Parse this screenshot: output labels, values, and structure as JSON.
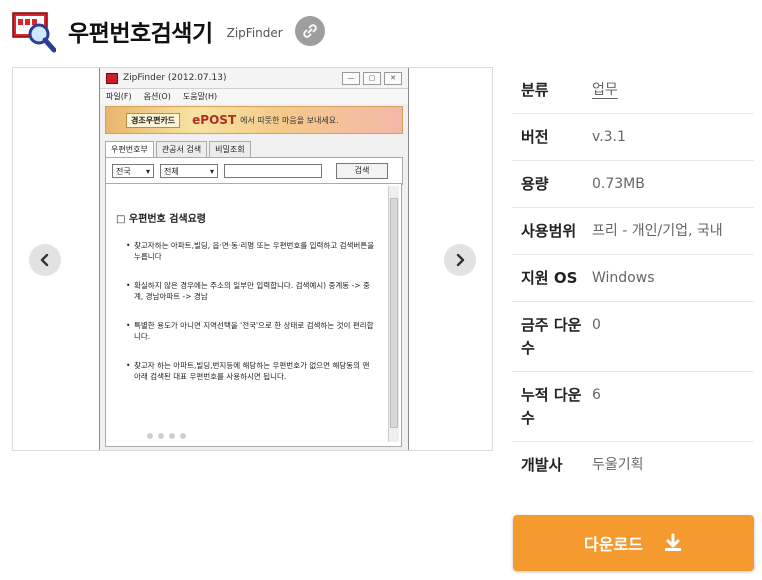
{
  "header": {
    "title": "우편번호검색기",
    "subtitle": "ZipFinder"
  },
  "screenshot": {
    "window_title": "ZipFinder (2012.07.13)",
    "menu": [
      "파일(F)",
      "옵션(O)",
      "도움말(H)"
    ],
    "banner": {
      "card_label": "경조우편카드",
      "brand": "ePOST",
      "tagline": "에서 따뜻한 마음을 보내세요."
    },
    "tabs": [
      "우편번호부",
      "관공서 검색",
      "비밀조회"
    ],
    "region_select": "전국",
    "district_select": "전체",
    "search_button": "검색",
    "guide_heading": "□ 우편번호 검색요령",
    "tips": [
      "찾고자하는 아파트,빌딩, 읍·면·동·리명 또는 우편번호를 입력하고 검색버튼을 누릅니다",
      "확실하지 않은 경우에는 주소의 일부만 입력합니다. 검색예시) 중계동 -> 중계, 경남아파트 -> 경남",
      "특별한 용도가 아니면 지역선택을 '전국'으로 한 상태로 검색하는 것이 편리합니다.",
      "찾고자 하는 아파트,빌딩,번지등에 해당하는 우편번호가 없으면 해당동의 맨 아래 검색된 대표 우편번호를 사용하시면 됩니다."
    ]
  },
  "info": [
    {
      "key": "분류",
      "value": "업무",
      "link": true
    },
    {
      "key": "버전",
      "value": "v.3.1"
    },
    {
      "key": "용량",
      "value": "0.73MB"
    },
    {
      "key": "사용범위",
      "value": "프리 - 개인/기업, 국내"
    },
    {
      "key": "지원 OS",
      "value": "Windows"
    },
    {
      "key": "금주 다운수",
      "value": "0"
    },
    {
      "key": "누적 다운수",
      "value": "6"
    },
    {
      "key": "개발사",
      "value": "두울기획"
    }
  ],
  "download": {
    "label": "다운로드"
  },
  "colors": {
    "accent": "#f59a2f",
    "nav_bg": "#e2e2e2",
    "link_btn": "#9e9e9e"
  }
}
